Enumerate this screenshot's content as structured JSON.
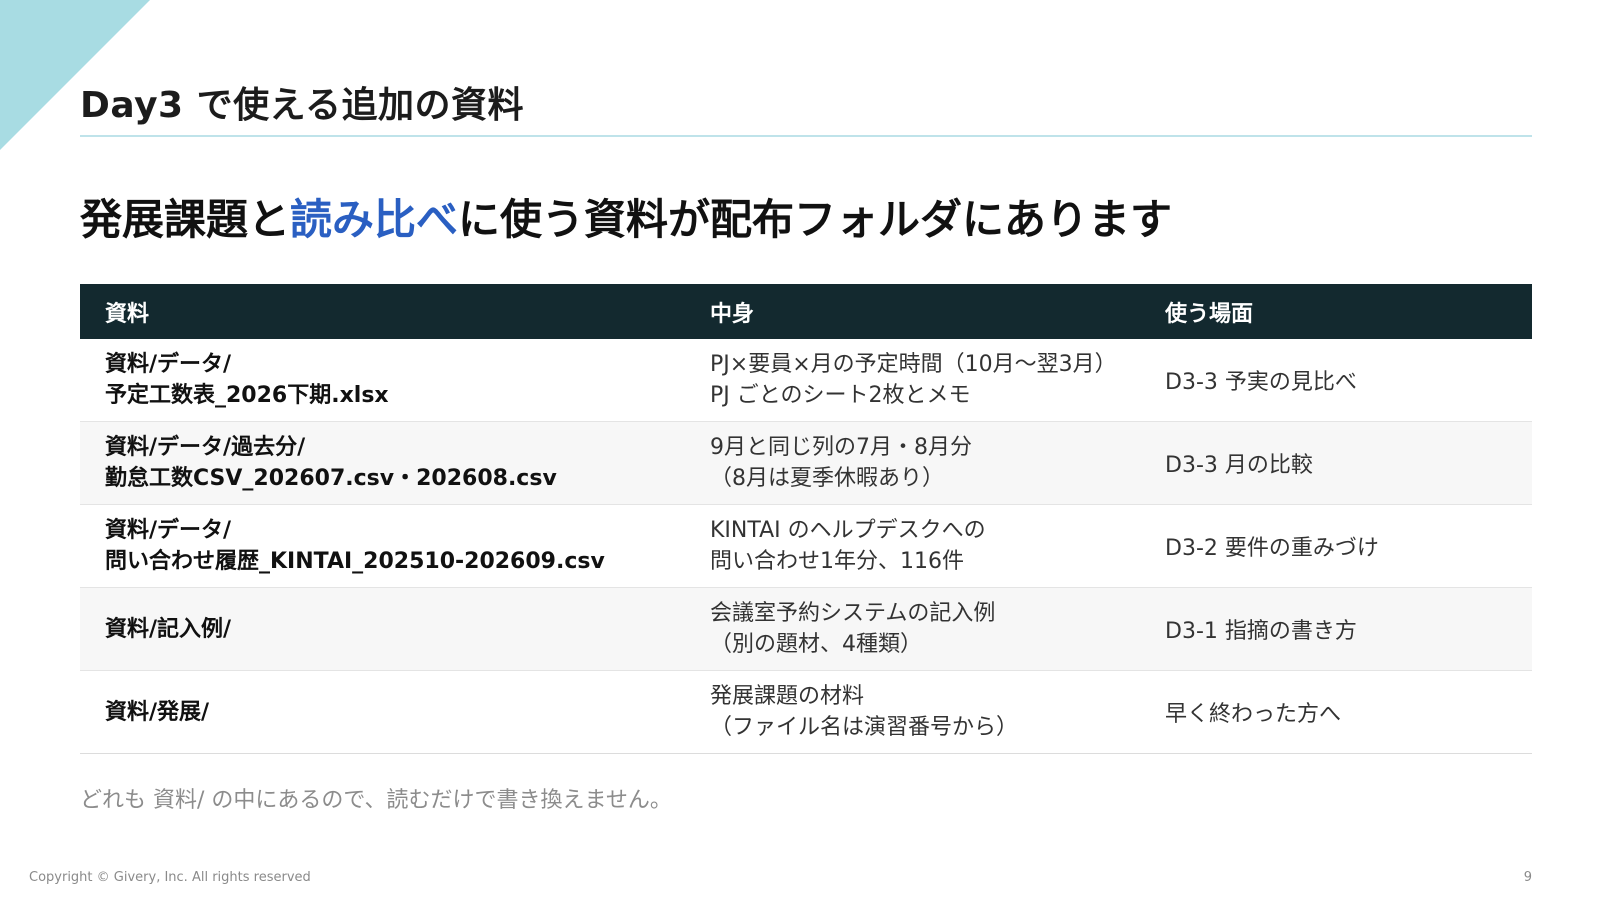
{
  "slide": {
    "title": "Day3 で使える追加の資料",
    "headline_before": "発展課題と",
    "headline_highlight": "読み比べ",
    "headline_after": "に使う資料が配布フォルダにあります",
    "note": "どれも 資料/ の中にあるので、読むだけで書き換えません。",
    "copyright": "Copyright © Givery, Inc. All rights reserved",
    "page_number": "9"
  },
  "table": {
    "headers": [
      "資料",
      "中身",
      "使う場面"
    ],
    "rows": [
      {
        "path": "資料/データ/\n予定工数表_2026下期.xlsx",
        "content": "PJ×要員×月の予定時間（10月〜翌3月）\nPJ ごとのシート2枚とメモ",
        "use": "D3-3 予実の見比べ"
      },
      {
        "path": "資料/データ/過去分/\n勤怠工数CSV_202607.csv・202608.csv",
        "content": "9月と同じ列の7月・8月分\n（8月は夏季休暇あり）",
        "use": "D3-3 月の比較"
      },
      {
        "path": "資料/データ/\n問い合わせ履歴_KINTAI_202510-202609.csv",
        "content": "KINTAI のヘルプデスクへの\n問い合わせ1年分、116件",
        "use": "D3-2 要件の重みづけ"
      },
      {
        "path": "資料/記入例/",
        "content": "会議室予約システムの記入例\n（別の題材、4種類）",
        "use": "D3-1 指摘の書き方"
      },
      {
        "path": "資料/発展/",
        "content": "発展課題の材料\n（ファイル名は演習番号から）",
        "use": "早く終わった方へ"
      }
    ]
  },
  "colors": {
    "header_bg": "#13292f",
    "highlight": "#2a5fc2",
    "accent_triangle": "#a8dce3",
    "title_rule": "#bfe3ea"
  }
}
